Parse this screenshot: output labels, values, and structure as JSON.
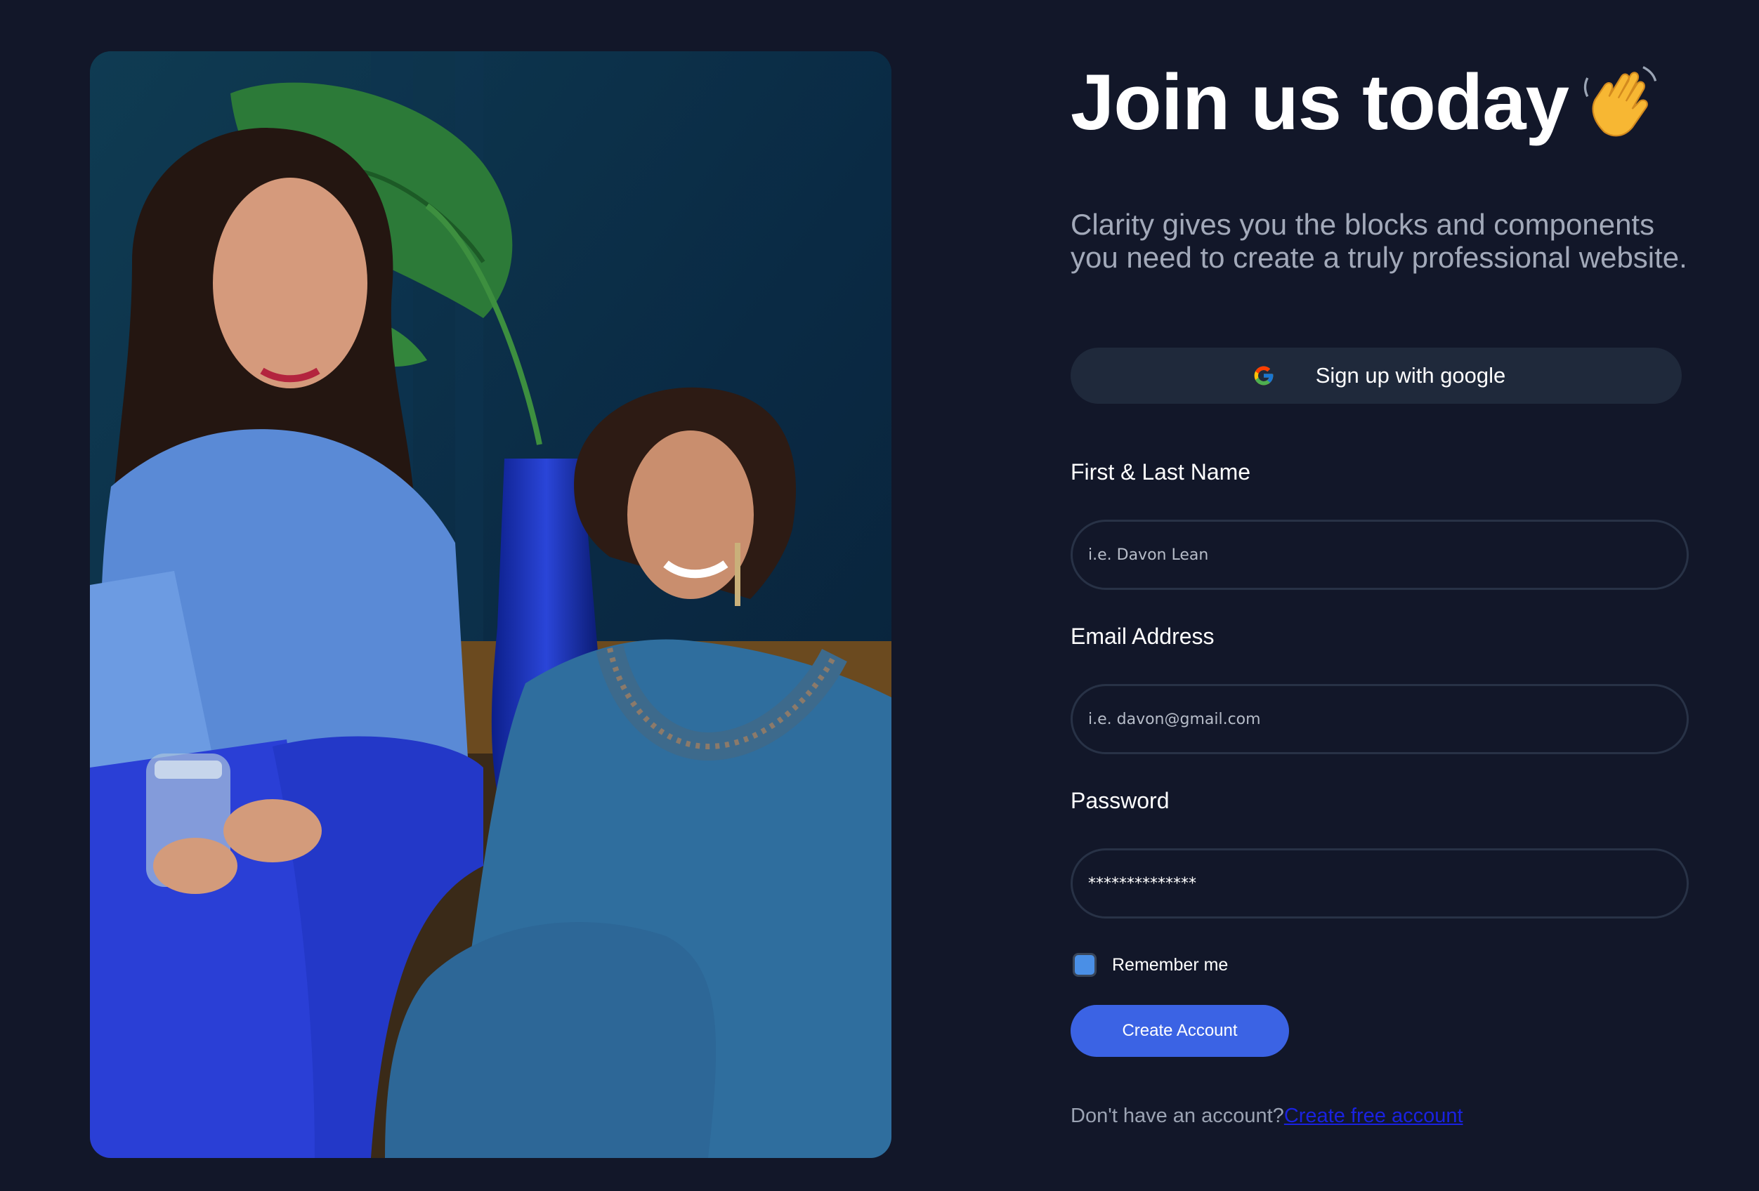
{
  "hero": {
    "image_description": "photo-two-women-smiling"
  },
  "form": {
    "title": "Join us today",
    "title_emoji_icon": "waving-hand-icon",
    "subtitle": "Clarity gives you the blocks and components you need to create a truly professional website.",
    "google_button": {
      "icon": "google-g-icon",
      "label": "Sign up with google"
    },
    "fields": {
      "name": {
        "label": "First & Last Name",
        "placeholder": "i.e. Davon Lean",
        "value": ""
      },
      "email": {
        "label": "Email Address",
        "placeholder": "i.e. davon@gmail.com",
        "value": ""
      },
      "password": {
        "label": "Password",
        "placeholder": "",
        "value": "**************"
      }
    },
    "remember": {
      "label": "Remember me",
      "checked": true
    },
    "submit_label": "Create Account",
    "footer": {
      "prompt": "Don't have an account?",
      "link_label": "Create free account"
    }
  },
  "colors": {
    "page_background": "#121729",
    "primary_button": "#3b63e4",
    "google_button_bg": "#1f293b",
    "input_border": "#283246",
    "checkbox_fill": "#4a8fe6",
    "link": "#1a22e0"
  }
}
